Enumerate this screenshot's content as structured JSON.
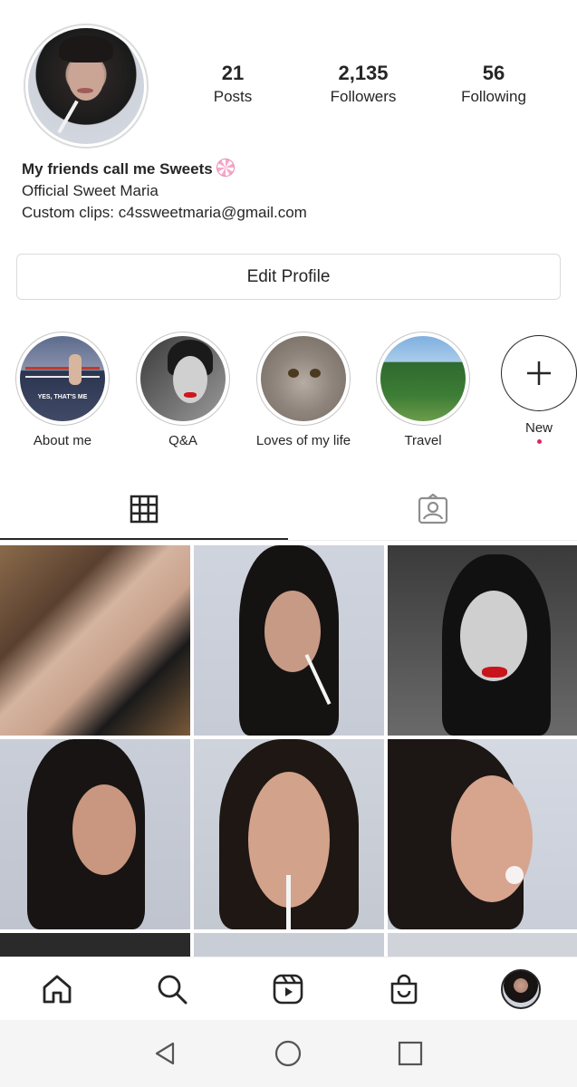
{
  "profile": {
    "avatar_alt": "profile-photo",
    "stats": [
      {
        "value": "21",
        "label": "Posts"
      },
      {
        "value": "2,135",
        "label": "Followers"
      },
      {
        "value": "56",
        "label": "Following"
      }
    ],
    "bio": {
      "name": "My friends call me Sweets",
      "name_emoji": "lollipop-icon",
      "line2": "Official Sweet Maria",
      "line3": "Custom clips: c4ssweetmaria@gmail.com"
    },
    "edit_button": "Edit Profile"
  },
  "highlights": [
    {
      "label": "About me",
      "caption": "YES, THAT'S ME"
    },
    {
      "label": "Q&A"
    },
    {
      "label": "Loves of my life"
    },
    {
      "label": "Travel"
    },
    {
      "label": "New"
    }
  ],
  "tabs": [
    {
      "name": "grid-icon",
      "active": true
    },
    {
      "name": "tagged-icon",
      "active": false
    }
  ],
  "bottom_nav": [
    "home-icon",
    "search-icon",
    "reels-icon",
    "shop-icon",
    "profile-avatar"
  ],
  "system_nav": [
    "back-icon",
    "home-circle-icon",
    "recents-icon"
  ],
  "colors": {
    "text": "#262626",
    "border": "#dbdbdb",
    "badge_dot": "#e0245e"
  }
}
